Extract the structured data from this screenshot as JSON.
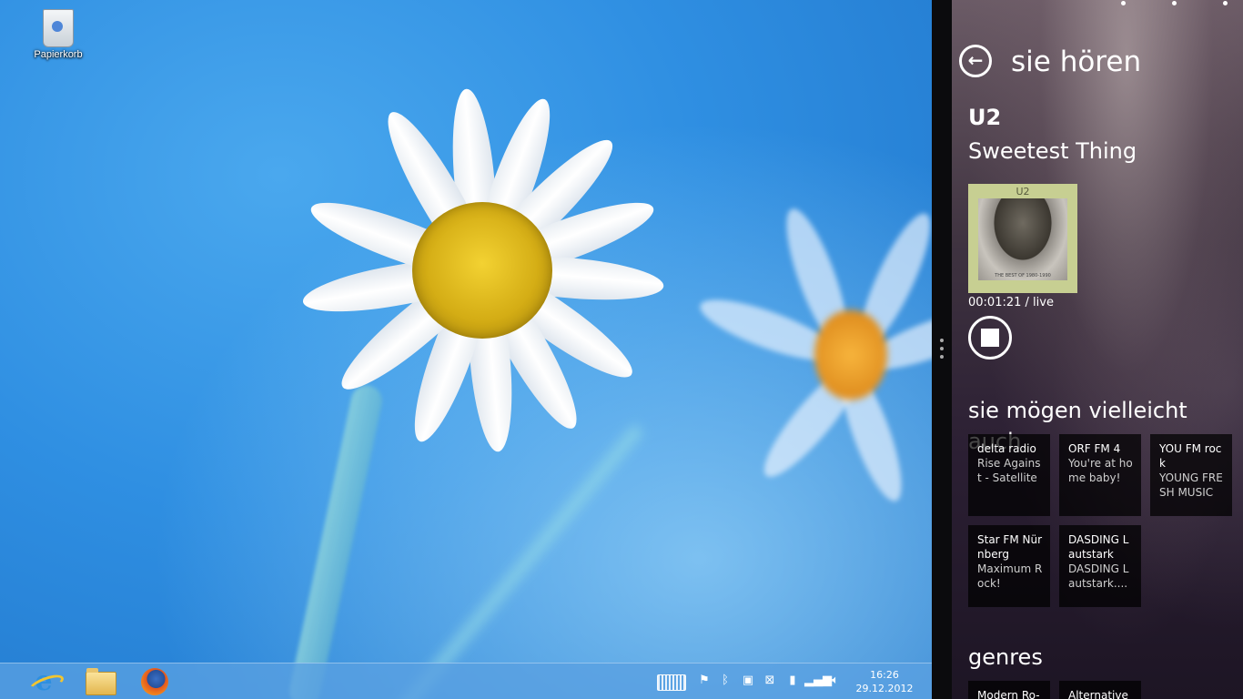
{
  "desktop": {
    "recycle_bin_label": "Papierkorb",
    "wallpaper": {
      "sky_color": "#2f8fe2",
      "petal_color": "#ffffff",
      "center_color": "#d4ad15"
    }
  },
  "taskbar": {
    "pinned_apps": [
      {
        "name": "Internet Explorer",
        "icon": "internet-explorer-icon"
      },
      {
        "name": "Windows Explorer",
        "icon": "folder-icon"
      },
      {
        "name": "Firefox",
        "icon": "firefox-icon"
      }
    ],
    "tray_icons": [
      "keyboard-icon",
      "action-center-icon",
      "bluetooth-icon",
      "network-monitor-icon",
      "network-error-icon",
      "battery-icon",
      "signal-icon",
      "volume-icon"
    ],
    "clock": {
      "time": "16:26",
      "date": "29.12.2012"
    },
    "color": "#5aa0e1"
  },
  "app": {
    "title": "sie hören",
    "now_playing": {
      "artist": "U2",
      "song": "Sweetest Thing",
      "album_label": "U2",
      "album_subtitle": "THE BEST OF 1980-1990",
      "time": "00:01:21 /",
      "status": "live"
    },
    "suggestions_title": "sie mögen vielleicht auch",
    "suggestions": [
      {
        "station": "delta radio",
        "song": "Rise Against - Satellite"
      },
      {
        "station": "ORF FM 4",
        "song": "You're at home baby!"
      },
      {
        "station": "YOU FM rock",
        "song": "YOUNG FRESH MUSIC"
      },
      {
        "station": "Star FM Nürnberg",
        "song": "Maximum Rock!"
      },
      {
        "station": "DASDING Lautstark",
        "song": "DASDING Lautstark...."
      }
    ],
    "genres_title": "genres",
    "genres": [
      "Modern Ro-",
      "Alternative"
    ],
    "accent": "#ffffff"
  }
}
